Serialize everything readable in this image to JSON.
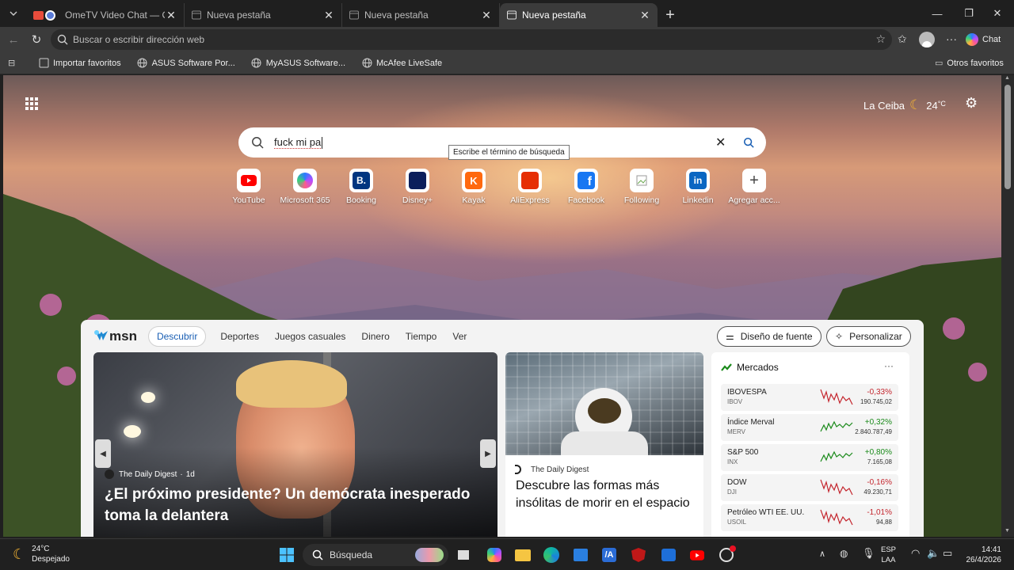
{
  "browser": {
    "tabs": [
      {
        "label": "OmeTV Video Chat — Omegl",
        "active": false
      },
      {
        "label": "Nueva pestaña",
        "active": false
      },
      {
        "label": "Nueva pestaña",
        "active": false
      },
      {
        "label": "Nueva pestaña",
        "active": true
      }
    ],
    "address_placeholder": "Buscar o escribir dirección web",
    "chat_label": "Chat",
    "favorites": [
      {
        "label": "Importar favoritos",
        "icon": "import-icon"
      },
      {
        "label": "ASUS Software Por...",
        "icon": "globe-icon"
      },
      {
        "label": "MyASUS Software...",
        "icon": "globe-icon"
      },
      {
        "label": "McAfee LiveSafe",
        "icon": "globe-icon"
      }
    ],
    "other_favorites": "Otros favoritos"
  },
  "newtab": {
    "weather": {
      "city": "La Ceiba",
      "temp": "24",
      "unit": "°C"
    },
    "search": {
      "query": "fuck mi pa",
      "tooltip": "Escribe el término de búsqueda"
    },
    "quick_links": [
      {
        "label": "YouTube",
        "icon": "youtube-icon",
        "color": "#ff0000"
      },
      {
        "label": "Microsoft 365",
        "icon": "microsoft365-icon",
        "color": "#7b61ff"
      },
      {
        "label": "Booking",
        "icon": "booking-icon",
        "color": "#003580"
      },
      {
        "label": "Disney+",
        "icon": "disney-icon",
        "color": "#0b1e5b"
      },
      {
        "label": "Kayak",
        "icon": "kayak-icon",
        "color": "#ff690f"
      },
      {
        "label": "AliExpress",
        "icon": "aliexpress-icon",
        "color": "#e62e04"
      },
      {
        "label": "Facebook",
        "icon": "facebook-icon",
        "color": "#1877f2"
      },
      {
        "label": "Following",
        "icon": "following-icon",
        "color": "#cccccc"
      },
      {
        "label": "Linkedin",
        "icon": "linkedin-icon",
        "color": "#0a66c2"
      },
      {
        "label": "Agregar acc...",
        "icon": "plus-icon",
        "color": "#444444"
      }
    ]
  },
  "msn": {
    "brand": "msn",
    "nav": [
      "Descubrir",
      "Deportes",
      "Juegos casuales",
      "Dinero",
      "Tiempo",
      "Ver"
    ],
    "font_design": "Diseño de fuente",
    "personalize": "Personalizar",
    "feature": {
      "source": "The Daily Digest",
      "age": "1d",
      "title": "¿El próximo presidente? Un demócrata inesperado toma la delantera"
    },
    "story2": {
      "source": "The Daily Digest",
      "title": "Descubre las formas más insólitas de morir en el espacio"
    },
    "markets": {
      "title": "Mercados",
      "rows": [
        {
          "name": "IBOVESPA",
          "code": "IBOV",
          "change": "-0,33%",
          "value": "190.745,02",
          "trend": "down"
        },
        {
          "name": "Índice Merval",
          "code": "MERV",
          "change": "+0,32%",
          "value": "2.840.787,49",
          "trend": "up"
        },
        {
          "name": "S&P 500",
          "code": "INX",
          "change": "+0,80%",
          "value": "7.165,08",
          "trend": "up"
        },
        {
          "name": "DOW",
          "code": "DJI",
          "change": "-0,16%",
          "value": "49.230,71",
          "trend": "down"
        },
        {
          "name": "Petróleo WTI EE. UU.",
          "code": "USOIL",
          "change": "-1,01%",
          "value": "94,88",
          "trend": "down"
        }
      ]
    }
  },
  "taskbar": {
    "weather_temp": "24°C",
    "weather_desc": "Despejado",
    "search_label": "Búsqueda",
    "lang": "ESP",
    "layout": "LAA",
    "time": "14:41",
    "date": "26/4/2026"
  },
  "colors": {
    "up": "#1a8a1a",
    "down": "#c4262e",
    "link": "#1a5fb4"
  }
}
